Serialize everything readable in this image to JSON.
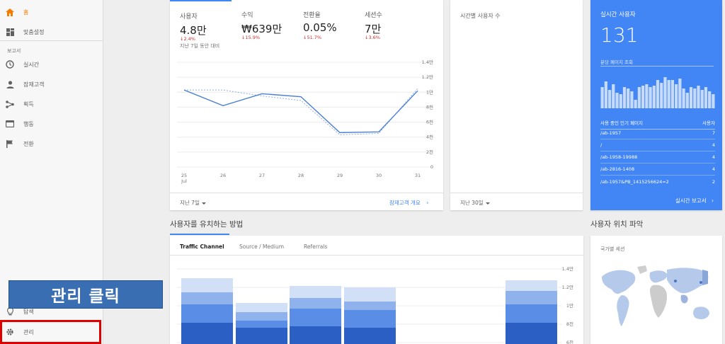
{
  "sidebar": {
    "home": "홈",
    "custom": "맞춤설정",
    "section": "보고서",
    "items": [
      "실시간",
      "잠재고객",
      "획득",
      "행동",
      "전환"
    ],
    "discover": "탐색",
    "admin": "관리"
  },
  "banner": "관리 클릭",
  "metrics": [
    {
      "label": "사용자",
      "value": "4.8만",
      "change": "2.4%"
    },
    {
      "label": "수익",
      "value": "₩639만",
      "change": "15.9%"
    },
    {
      "label": "전환율",
      "value": "0.05%",
      "change": "51.7%"
    },
    {
      "label": "세션수",
      "value": "7만",
      "change": "3.6%"
    }
  ],
  "compare_text": "지난 7일 동안 대비",
  "chart_data": {
    "type": "line",
    "categories": [
      "25",
      "26",
      "27",
      "28",
      "29",
      "30",
      "31"
    ],
    "x_sub": "Jul",
    "y_ticks": [
      "1.4만",
      "1.2만",
      "1만",
      "8천",
      "6천",
      "4천",
      "2천",
      "0"
    ],
    "ylim": [
      0,
      14000
    ],
    "series": [
      {
        "values": [
          10300,
          8200,
          9800,
          9400,
          4600,
          4700,
          10200
        ]
      },
      {
        "values": [
          10300,
          10300,
          9500,
          8900,
          4300,
          4500,
          10500
        ]
      }
    ]
  },
  "card1_footer": {
    "range": "지난 7일",
    "link": "잠재고객 개요"
  },
  "card2": {
    "title": "시간별 사용자 수",
    "range": "지난 30일"
  },
  "realtime": {
    "title": "실시간 사용자",
    "count": "131",
    "sub": "분당 페이지 조회",
    "table_header": "사용 중인 인기 페이지",
    "table_col": "사용자",
    "rows": [
      {
        "page": "/ab-1957",
        "users": "7"
      },
      {
        "page": "/",
        "users": "4"
      },
      {
        "page": "/ab-1958-19988",
        "users": "4"
      },
      {
        "page": "/ab-2816-1408",
        "users": "4"
      },
      {
        "page": "/ab-1957&PB_1415256624=2",
        "users": "2"
      }
    ],
    "footer": "실시간 보고서"
  },
  "retain": {
    "title": "사용자를 유치하는 방법",
    "tabs": [
      "Traffic Channel",
      "Source / Medium",
      "Referrals"
    ],
    "y_ticks": [
      "1.4만",
      "1.2만",
      "1만",
      "8천",
      "6천"
    ]
  },
  "location": {
    "title": "사용자 위치 파악",
    "sub": "국가별 세션"
  }
}
